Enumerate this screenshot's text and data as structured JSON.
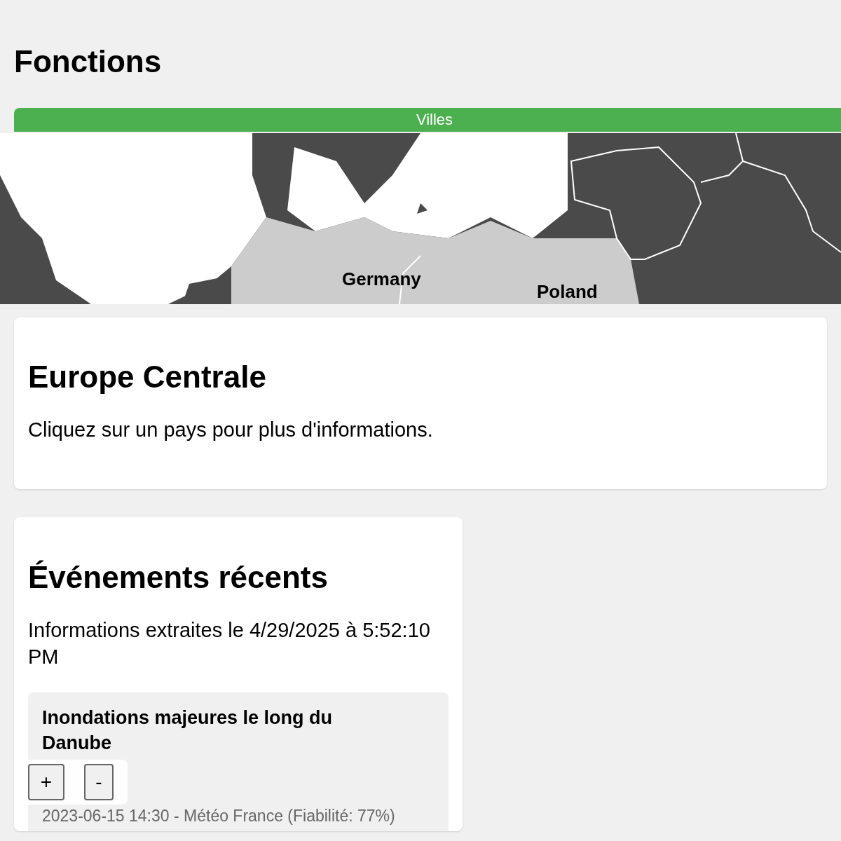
{
  "page": {
    "title": "Fonctions"
  },
  "villes_button": {
    "label": "Villes"
  },
  "map": {
    "labels": [
      {
        "name": "Germany"
      },
      {
        "name": "Poland"
      }
    ]
  },
  "region_card": {
    "title": "Europe Centrale",
    "text": "Cliquez sur un pays pour plus d'informations."
  },
  "events": {
    "title": "Événements récents",
    "extracted": "Informations extraites le 4/29/2025 à 5:52:10 PM",
    "items": [
      {
        "title": "Inondations majeures le long du Danube",
        "meta": "2023-06-15 14:30 - Météo France (Fiabilité: 77%)"
      }
    ]
  },
  "zoom_controls": [
    {
      "label": "+"
    },
    {
      "label": "-"
    }
  ]
}
